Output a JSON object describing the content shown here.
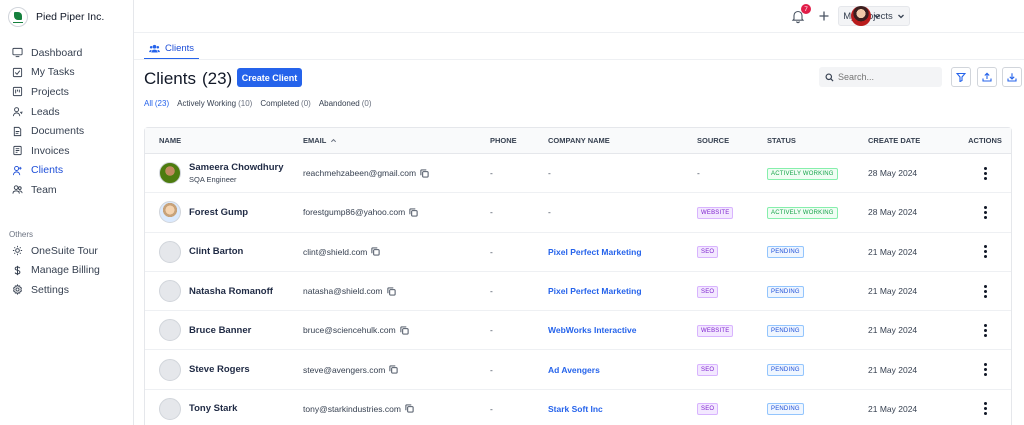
{
  "sidebar": {
    "brand": "Pied Piper Inc.",
    "nav": [
      {
        "label": "Dashboard",
        "icon": "dashboard-icon",
        "active": false
      },
      {
        "label": "My Tasks",
        "icon": "tasks-icon",
        "active": false
      },
      {
        "label": "Projects",
        "icon": "projects-icon",
        "active": false
      },
      {
        "label": "Leads",
        "icon": "leads-icon",
        "active": false
      },
      {
        "label": "Documents",
        "icon": "documents-icon",
        "active": false
      },
      {
        "label": "Invoices",
        "icon": "invoices-icon",
        "active": false
      },
      {
        "label": "Clients",
        "icon": "clients-icon",
        "active": true
      },
      {
        "label": "Team",
        "icon": "team-icon",
        "active": false
      }
    ],
    "others_label": "Others",
    "others": [
      {
        "label": "OneSuite Tour",
        "icon": "tour-icon"
      },
      {
        "label": "Manage Billing",
        "icon": "dollar-icon"
      },
      {
        "label": "Settings",
        "icon": "gear-icon"
      }
    ]
  },
  "topbar": {
    "projects_label": "My Projects",
    "notification_count": "7"
  },
  "page": {
    "tab_label": "Clients",
    "title": "Clients",
    "count": "(23)",
    "create_label": "Create Client",
    "search_placeholder": "Search...",
    "filters": [
      {
        "label": "All",
        "count": "(23)",
        "active": true
      },
      {
        "label": "Actively Working",
        "count": "(10)",
        "active": false
      },
      {
        "label": "Completed",
        "count": "(0)",
        "active": false
      },
      {
        "label": "Abandoned",
        "count": "(0)",
        "active": false
      }
    ]
  },
  "table": {
    "headers": {
      "name": "NAME",
      "email": "EMAIL",
      "phone": "PHONE",
      "company": "COMPANY NAME",
      "source": "SOURCE",
      "status": "STATUS",
      "date": "CREATE DATE",
      "actions": "ACTIONS"
    },
    "rows": [
      {
        "name": "Sameera Chowdhury",
        "title": "SQA Engineer",
        "email": "reachmehzabeen@gmail.com",
        "phone": "-",
        "company": "-",
        "source": "-",
        "status": "ACTIVELY WORKING",
        "date": "28 May 2024",
        "avatar": "photo1"
      },
      {
        "name": "Forest Gump",
        "title": "",
        "email": "forestgump86@yahoo.com",
        "phone": "-",
        "company": "-",
        "source": "WEBSITE",
        "status": "ACTIVELY WORKING",
        "date": "28 May 2024",
        "avatar": "photo2"
      },
      {
        "name": "Clint Barton",
        "title": "",
        "email": "clint@shield.com",
        "phone": "-",
        "company": "Pixel Perfect Marketing",
        "source": "SEO",
        "status": "PENDING",
        "date": "21 May 2024",
        "avatar": "blank"
      },
      {
        "name": "Natasha Romanoff",
        "title": "",
        "email": "natasha@shield.com",
        "phone": "-",
        "company": "Pixel Perfect Marketing",
        "source": "SEO",
        "status": "PENDING",
        "date": "21 May 2024",
        "avatar": "blank"
      },
      {
        "name": "Bruce Banner",
        "title": "",
        "email": "bruce@sciencehulk.com",
        "phone": "-",
        "company": "WebWorks Interactive",
        "source": "WEBSITE",
        "status": "PENDING",
        "date": "21 May 2024",
        "avatar": "blank"
      },
      {
        "name": "Steve Rogers",
        "title": "",
        "email": "steve@avengers.com",
        "phone": "-",
        "company": "Ad Avengers",
        "source": "SEO",
        "status": "PENDING",
        "date": "21 May 2024",
        "avatar": "blank"
      },
      {
        "name": "Tony Stark",
        "title": "",
        "email": "tony@starkindustries.com",
        "phone": "-",
        "company": "Stark Soft Inc",
        "source": "SEO",
        "status": "PENDING",
        "date": "21 May 2024",
        "avatar": "blank"
      }
    ]
  }
}
